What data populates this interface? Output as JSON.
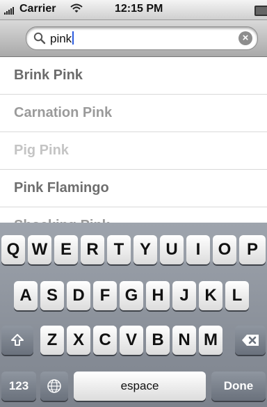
{
  "status_bar": {
    "carrier": "Carrier",
    "time": "12:15 PM"
  },
  "search": {
    "query": "pink"
  },
  "results": [
    {
      "label": "Brink Pink",
      "color": "#6b6b6b"
    },
    {
      "label": "Carnation Pink",
      "color": "#9a9a9a"
    },
    {
      "label": "Pig Pink",
      "color": "#c4c4c4"
    },
    {
      "label": "Pink Flamingo",
      "color": "#6e6e6e"
    },
    {
      "label": "Shocking Pink",
      "color": "#9a9a9a"
    }
  ],
  "keyboard": {
    "row1": [
      "Q",
      "W",
      "E",
      "R",
      "T",
      "Y",
      "U",
      "I",
      "O",
      "P"
    ],
    "row2": [
      "A",
      "S",
      "D",
      "F",
      "G",
      "H",
      "J",
      "K",
      "L"
    ],
    "row3": [
      "Z",
      "X",
      "C",
      "V",
      "B",
      "N",
      "M"
    ],
    "numbers_label": "123",
    "space_label": "espace",
    "done_label": "Done",
    "icons": [
      "shift-icon",
      "globe-icon",
      "backspace-icon"
    ]
  }
}
